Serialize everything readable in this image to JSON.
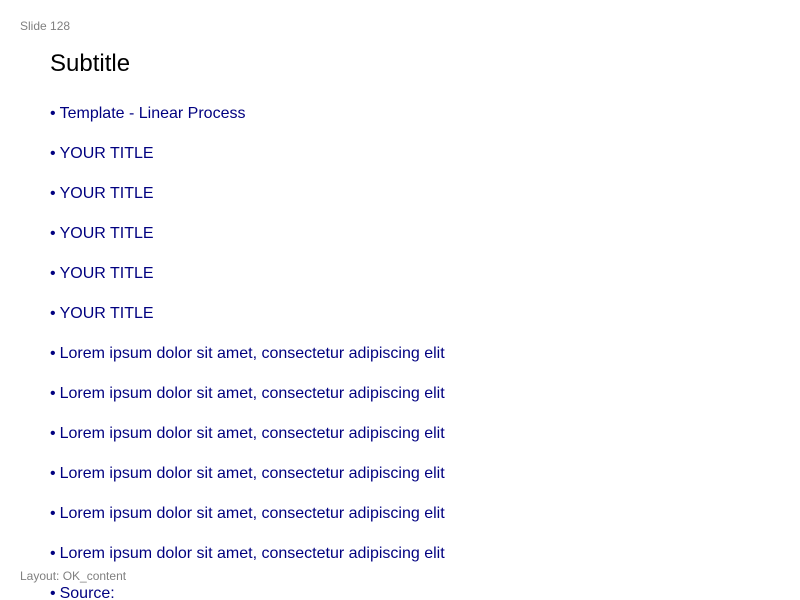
{
  "slide": {
    "number_label": "Slide 128",
    "subtitle": "Subtitle",
    "layout_label": "Layout: OK_content"
  },
  "bullet_glyph": "•",
  "bullets": [
    "Template - Linear Process",
    "YOUR TITLE",
    "YOUR TITLE",
    "YOUR TITLE",
    "YOUR TITLE",
    "YOUR TITLE",
    "Lorem ipsum dolor sit amet, consectetur adipiscing elit",
    "Lorem ipsum dolor sit amet, consectetur adipiscing elit",
    "Lorem ipsum dolor sit amet, consectetur adipiscing elit",
    "Lorem ipsum dolor sit amet, consectetur adipiscing elit",
    "Lorem ipsum dolor sit amet, consectetur adipiscing elit",
    "Lorem ipsum dolor sit amet, consectetur adipiscing elit",
    "Source:"
  ],
  "colors": {
    "bullet_text": "#000080",
    "subtitle_text": "#000000",
    "meta_text": "#808080"
  }
}
